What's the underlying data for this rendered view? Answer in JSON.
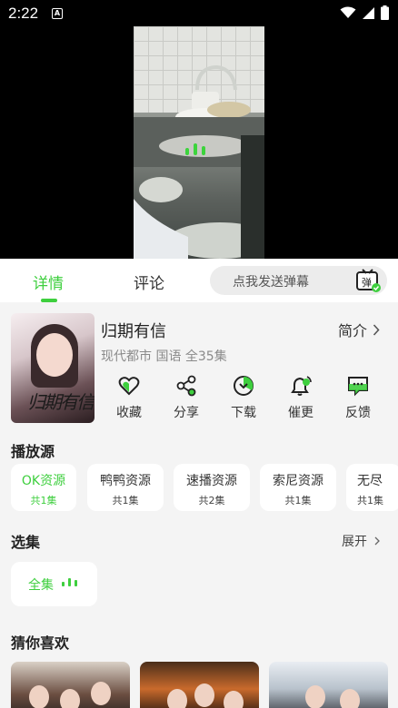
{
  "status_bar": {
    "time": "2:22",
    "app_icon": "A"
  },
  "player": {
    "state_icon": "loading-bars-icon"
  },
  "tabs": [
    {
      "label": "详情",
      "active": true
    },
    {
      "label": "评论",
      "active": false
    }
  ],
  "danmaku": {
    "placeholder": "点我发送弹幕",
    "icon": "danmaku-icon",
    "icon_text": "弹"
  },
  "drama": {
    "title": "归期有信",
    "meta": "现代都市 国语 全35集",
    "intro_label": "简介",
    "poster_text": "归期有信"
  },
  "actions": [
    {
      "label": "收藏",
      "icon": "heart-icon"
    },
    {
      "label": "分享",
      "icon": "share-icon"
    },
    {
      "label": "下载",
      "icon": "download-icon"
    },
    {
      "label": "催更",
      "icon": "bell-icon"
    },
    {
      "label": "反馈",
      "icon": "feedback-icon"
    }
  ],
  "sources": {
    "title": "播放源",
    "items": [
      {
        "name": "OK资源",
        "episodes": "共1集",
        "active": true
      },
      {
        "name": "鸭鸭资源",
        "episodes": "共1集",
        "active": false
      },
      {
        "name": "速播资源",
        "episodes": "共2集",
        "active": false
      },
      {
        "name": "索尼资源",
        "episodes": "共1集",
        "active": false
      },
      {
        "name": "无尽",
        "episodes": "共1集",
        "active": false
      }
    ]
  },
  "episodes": {
    "title": "选集",
    "expand_label": "展开",
    "items": [
      {
        "label": "全集",
        "playing": true
      }
    ]
  },
  "recommend": {
    "title": "猜你喜欢"
  },
  "colors": {
    "accent": "#3ecf3e",
    "background": "#f4f4f4",
    "card": "#ffffff"
  }
}
